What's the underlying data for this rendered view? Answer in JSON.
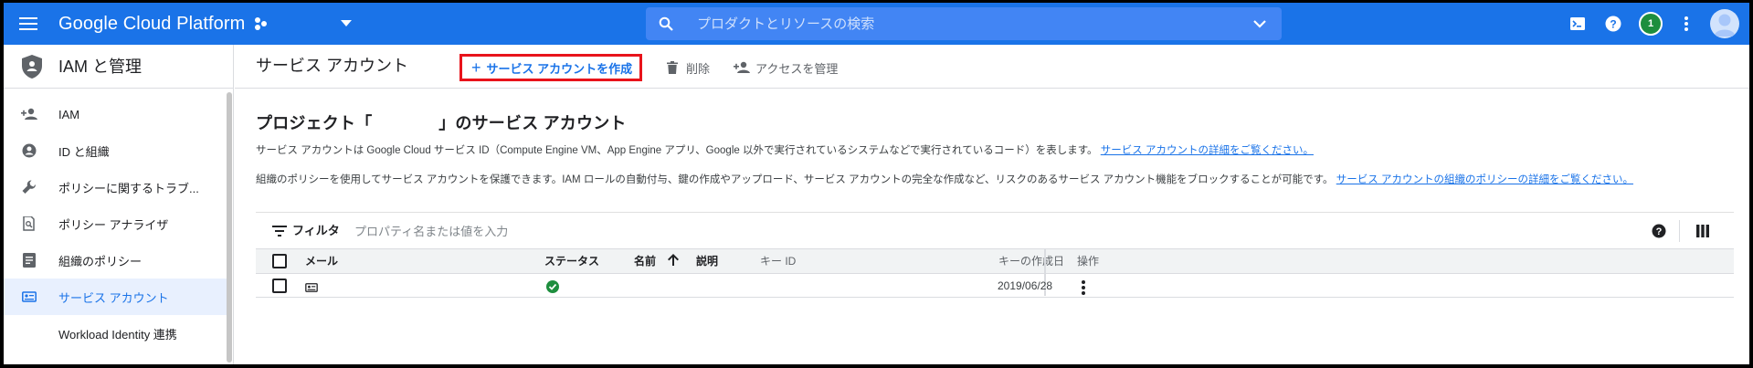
{
  "topbar": {
    "brand": "Google Cloud Platform",
    "search_placeholder": "プロダクトとリソースの検索",
    "notification_count": "1",
    "color": "#1a73e8"
  },
  "sidebar": {
    "title": "IAM と管理",
    "items": [
      {
        "label": "IAM",
        "icon": "person-add-icon"
      },
      {
        "label": "ID と組織",
        "icon": "account-circle-icon"
      },
      {
        "label": "ポリシーに関するトラブ...",
        "icon": "wrench-icon"
      },
      {
        "label": "ポリシー アナライザ",
        "icon": "document-search-icon"
      },
      {
        "label": "組織のポリシー",
        "icon": "list-document-icon"
      },
      {
        "label": "サービス アカウント",
        "icon": "service-account-icon",
        "active": true
      },
      {
        "label": "Workload Identity 連携",
        "icon": ""
      }
    ]
  },
  "toolbar": {
    "page_title": "サービス アカウント",
    "create_label": "サービス アカウントを作成",
    "delete_label": "削除",
    "manage_access_label": "アクセスを管理"
  },
  "content": {
    "section_title": "プロジェクト「　　　　」のサービス アカウント",
    "desc1_text": "サービス アカウントは Google Cloud サービス ID（Compute Engine VM、App Engine アプリ、Google 以外で実行されているシステムなどで実行されているコード）を表します。",
    "desc1_link": "サービス アカウントの詳細をご覧ください。",
    "desc2_text": "組織のポリシーを使用してサービス アカウントを保護できます。IAM ロールの自動付与、鍵の作成やアップロード、サービス アカウントの完全な作成など、リスクのあるサービス アカウント機能をブロックすることが可能です。",
    "desc2_link": "サービス アカウントの組織のポリシーの詳細をご覧ください。"
  },
  "filter": {
    "label": "フィルタ",
    "placeholder": "プロパティ名または値を入力"
  },
  "table": {
    "columns": {
      "email": "メール",
      "status": "ステータス",
      "name": "名前",
      "description": "説明",
      "key_id": "キー ID",
      "key_created": "キーの作成日",
      "actions": "操作"
    },
    "rows": [
      {
        "email": "",
        "status": "enabled",
        "name": "",
        "description": "",
        "key_id": "",
        "key_created": "2019/06/28"
      }
    ]
  }
}
